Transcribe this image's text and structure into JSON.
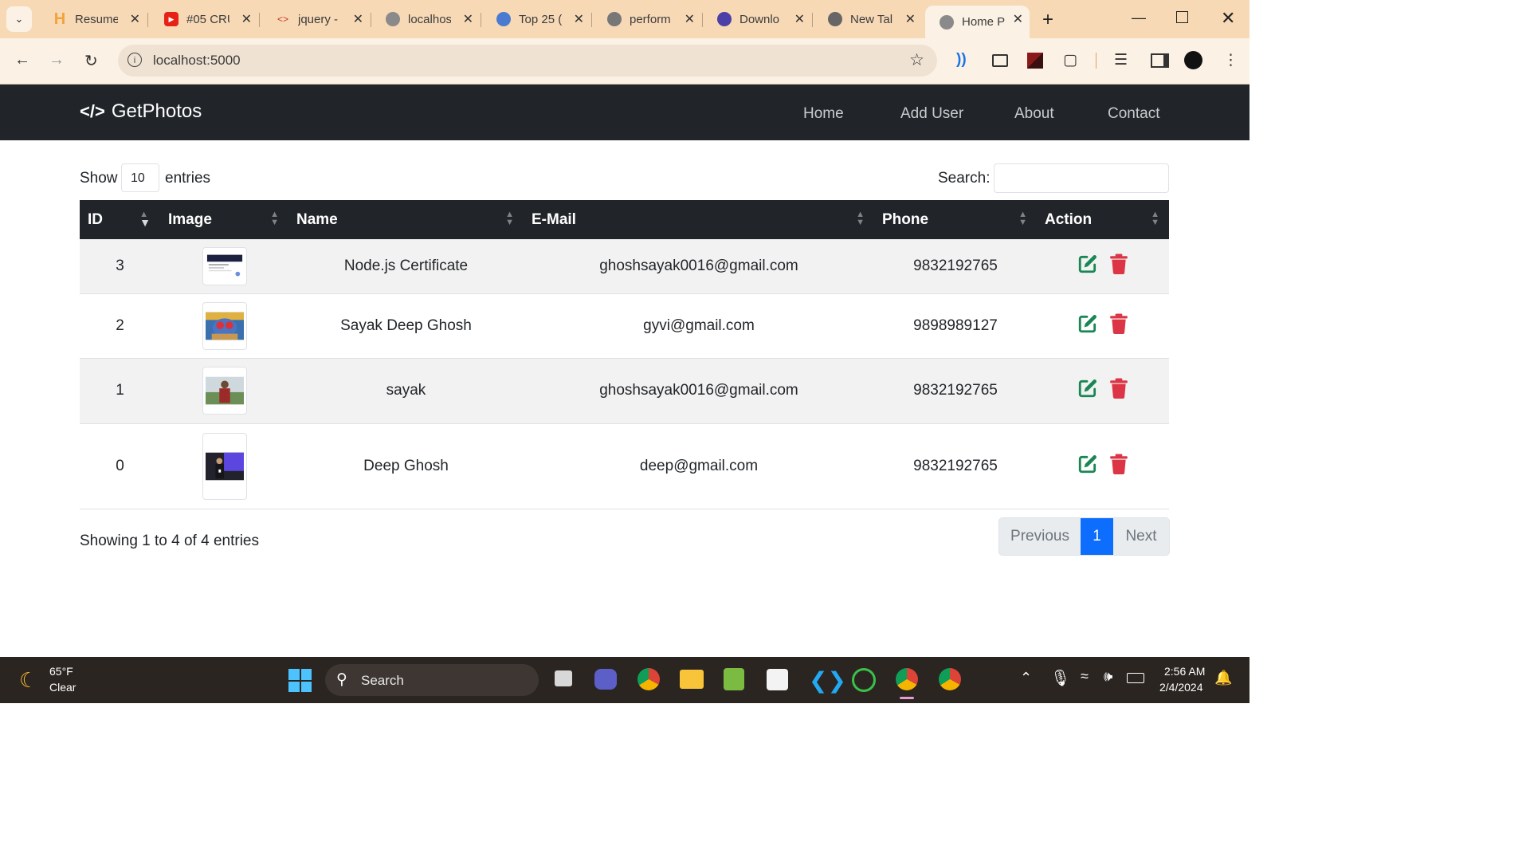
{
  "browser": {
    "tabs": [
      {
        "label": "Resume",
        "icon": "h-logo-icon",
        "color": "#f2a33a"
      },
      {
        "label": "#05 CRU",
        "icon": "youtube-icon",
        "color": "#e62117"
      },
      {
        "label": "jquery -",
        "icon": "code-icon",
        "color": "#c0392b"
      },
      {
        "label": "localhos",
        "icon": "globe-icon",
        "color": "#8a8a8a"
      },
      {
        "label": "Top 25 (",
        "icon": "chrome-devtools-icon",
        "color": "#4a7bd0"
      },
      {
        "label": "perform",
        "icon": "google-icon",
        "color": "#777777"
      },
      {
        "label": "Downlo",
        "icon": "circle-icon",
        "color": "#4b3fa8"
      },
      {
        "label": "New Tal",
        "icon": "chrome-icon",
        "color": "#666666"
      },
      {
        "label": "Home P",
        "icon": "globe-icon",
        "color": "#8a8a8a"
      }
    ],
    "url": "localhost:5000"
  },
  "app": {
    "brand": "GetPhotos",
    "nav": [
      "Home",
      "Add User",
      "About",
      "Contact"
    ]
  },
  "table_controls": {
    "show_label": "Show",
    "entries_value": "10",
    "entries_label": "entries",
    "search_label": "Search:",
    "search_value": ""
  },
  "table": {
    "columns": [
      "ID",
      "Image",
      "Name",
      "E-Mail",
      "Phone",
      "Action"
    ],
    "rows": [
      {
        "id": "3",
        "name": "Node.js Certificate",
        "email": "ghoshsayak0016@gmail.com",
        "phone": "9832192765",
        "image": "certificate"
      },
      {
        "id": "2",
        "name": "Sayak Deep Ghosh",
        "email": "gyvi@gmail.com",
        "phone": "9898989127",
        "image": "cartoon"
      },
      {
        "id": "1",
        "name": "sayak",
        "email": "ghoshsayak0016@gmail.com",
        "phone": "9832192765",
        "image": "portrait-outdoor"
      },
      {
        "id": "0",
        "name": "Deep Ghosh",
        "email": "deep@gmail.com",
        "phone": "9832192765",
        "image": "portrait-stage"
      }
    ]
  },
  "footer": {
    "info": "Showing 1 to 4 of 4 entries",
    "prev": "Previous",
    "page": "1",
    "next": "Next"
  },
  "taskbar": {
    "weather_temp": "65°F",
    "weather_desc": "Clear",
    "search_placeholder": "Search",
    "time": "2:56 AM",
    "date": "2/4/2024"
  },
  "colors": {
    "tabstrip": "#f7d9b6",
    "navbar": "#212529",
    "primary": "#0d6efd",
    "edit": "#198754",
    "delete": "#dc3545"
  }
}
